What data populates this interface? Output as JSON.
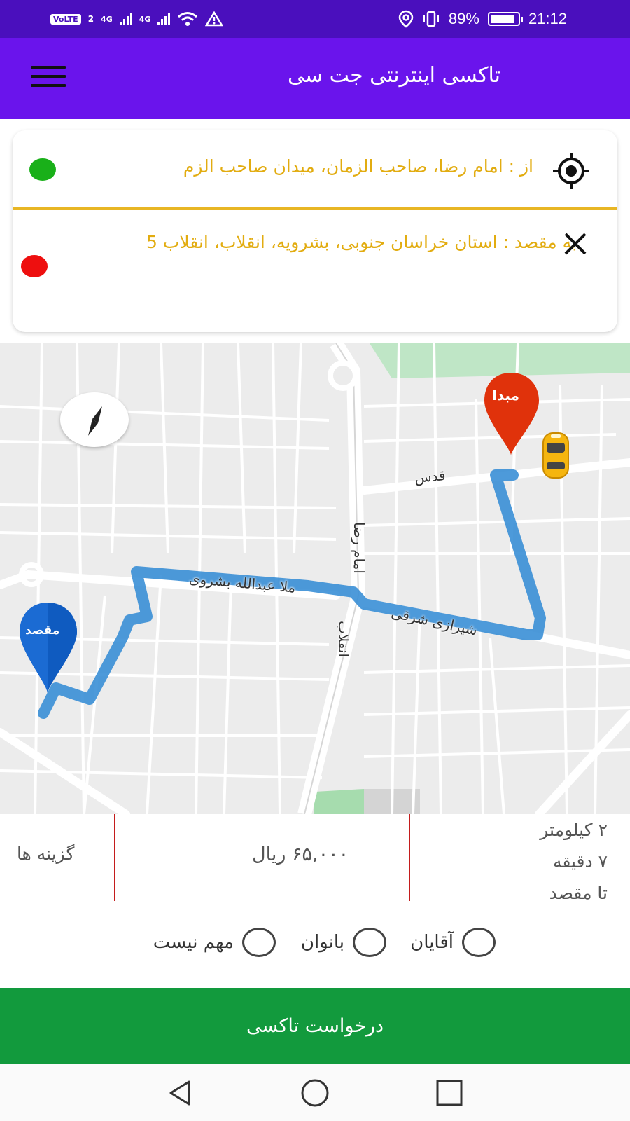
{
  "status_bar": {
    "volte": "VoLTE",
    "sim": "2",
    "net1": "4G",
    "net2": "4G",
    "battery_text": "89%",
    "battery_level": 0.89,
    "time": "21:12"
  },
  "header": {
    "title": "تاکسی اینترنتی جت سی",
    "menu_icon": "hamburger-icon",
    "color": "#6a14ec"
  },
  "addresses": {
    "from_text": "از :  امام رضا، صاحب الزمان، میدان صاحب الزم",
    "from_icon": "target-locate-icon",
    "to_text": "به مقصد : استان خراسان جنوبی، بشرویه، انقلاب، انقلاب 5",
    "to_icon": "close-icon",
    "text_color": "#e2ac10",
    "from_dot_color": "#19b019",
    "to_dot_color": "#ee0f0f"
  },
  "map": {
    "origin_pin_label": "مبدا",
    "destination_pin_label": "مقصد",
    "streets": {
      "quds": "قدس",
      "imam_reza": "امام رضا",
      "enghelab": "انقلاب",
      "molla": "ملا عبدالله بشروی",
      "shirazi": "شیرازی شرقی"
    },
    "route_color": "#3a8fd6",
    "origin_color": "#e0320b",
    "destination_color": "#1b6bd3"
  },
  "trip": {
    "options_label": "گزینه ها",
    "price": "۶۵,۰۰۰ ریال",
    "distance": "۲ کیلومتر",
    "duration": "۷ دقیقه",
    "to_destination": "تا مقصد"
  },
  "gender": {
    "men": "آقایان",
    "women": "بانوان",
    "any": "مهم نیست"
  },
  "request_button": "درخواست تاکسی",
  "request_color": "#129a3d"
}
